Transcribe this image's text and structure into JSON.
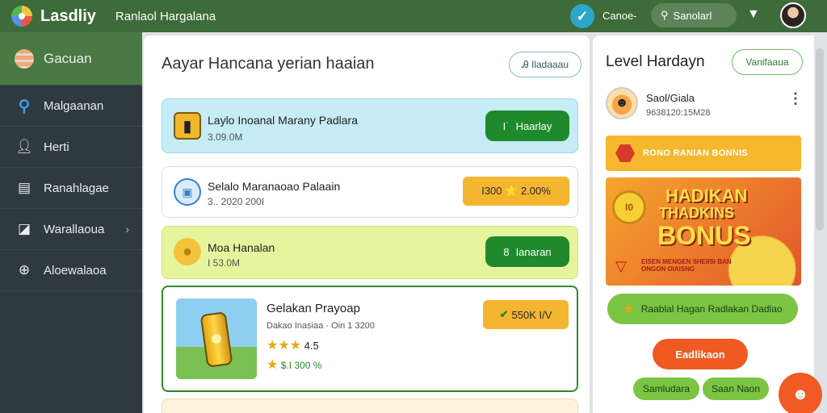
{
  "topbar": {
    "brand": "Lasdliy",
    "app_title": "Ranlaol Hargalana",
    "check_icon": "check-icon",
    "link": "Canoe-",
    "search_label": "Sanolarl",
    "mail_icon": "inbox-icon"
  },
  "sidebar": {
    "items": [
      {
        "label": "Gacuan",
        "icon": "burger-icon"
      },
      {
        "label": "Malgaanan",
        "icon": "search-icon"
      },
      {
        "label": "Herti",
        "icon": "user-icon"
      },
      {
        "label": "Ranahlagae",
        "icon": "document-icon"
      },
      {
        "label": "Warallaoua",
        "icon": "folder-icon",
        "chevron": "›"
      },
      {
        "label": "Aloewalaoa",
        "icon": "globe-icon"
      }
    ]
  },
  "main": {
    "title": "Aayar Hancana yerian haaian",
    "top_button": "Ꭿ Iladaaau",
    "cards": [
      {
        "title": "Laylo Inoanal Marany Padlara",
        "sub": "3.09.0M",
        "button": "Haarlay",
        "button_icon": "I˙",
        "color": "#c6ecf6"
      },
      {
        "title": "Selalo Maranaoao Palaain",
        "sub": "3.. 2020 200I",
        "badge": "I300 ⭐ 2.00%",
        "color": "#ffffff"
      },
      {
        "title": "Moa Hanalan",
        "sub": "I 53.0M",
        "button": "Ianaran",
        "button_icon": "8",
        "color": "#e7f49e"
      },
      {
        "title": "Gelakan Prayoap",
        "sub": "Dakao Inasiaa · Oin 1 3200",
        "rating": "4.5",
        "price": "$.I 300 %",
        "badge": "550K I/V",
        "color": "#ffffff"
      }
    ]
  },
  "right": {
    "title": "Level Hardayn",
    "title_button": "Vanifaaua",
    "profile_name": "Saol/Giala",
    "profile_handle": "9638120:15M28",
    "more_icon": "⋮",
    "banner": "RONO RANIAN BONNIS",
    "bonus_coin": "I0",
    "bonus_line1": "HADIKAN",
    "bonus_line2": "THADKINS",
    "bonus_line3": "BONUS",
    "bonus_small": "EISEN MENGEN SHEIISI BAN ONGON OIAISNG",
    "long_button": "Raablal Hagan Radlakan Dadlao",
    "orange_button": "Eadlikaon",
    "chip1": "Samludara",
    "chip2": "Saan Naon"
  },
  "colors": {
    "topbar": "#3d6b3a",
    "sidebar": "#2f3a40",
    "accent_green": "#1f8a2c",
    "accent_orange": "#ef5a25",
    "gold": "#f4b531"
  }
}
